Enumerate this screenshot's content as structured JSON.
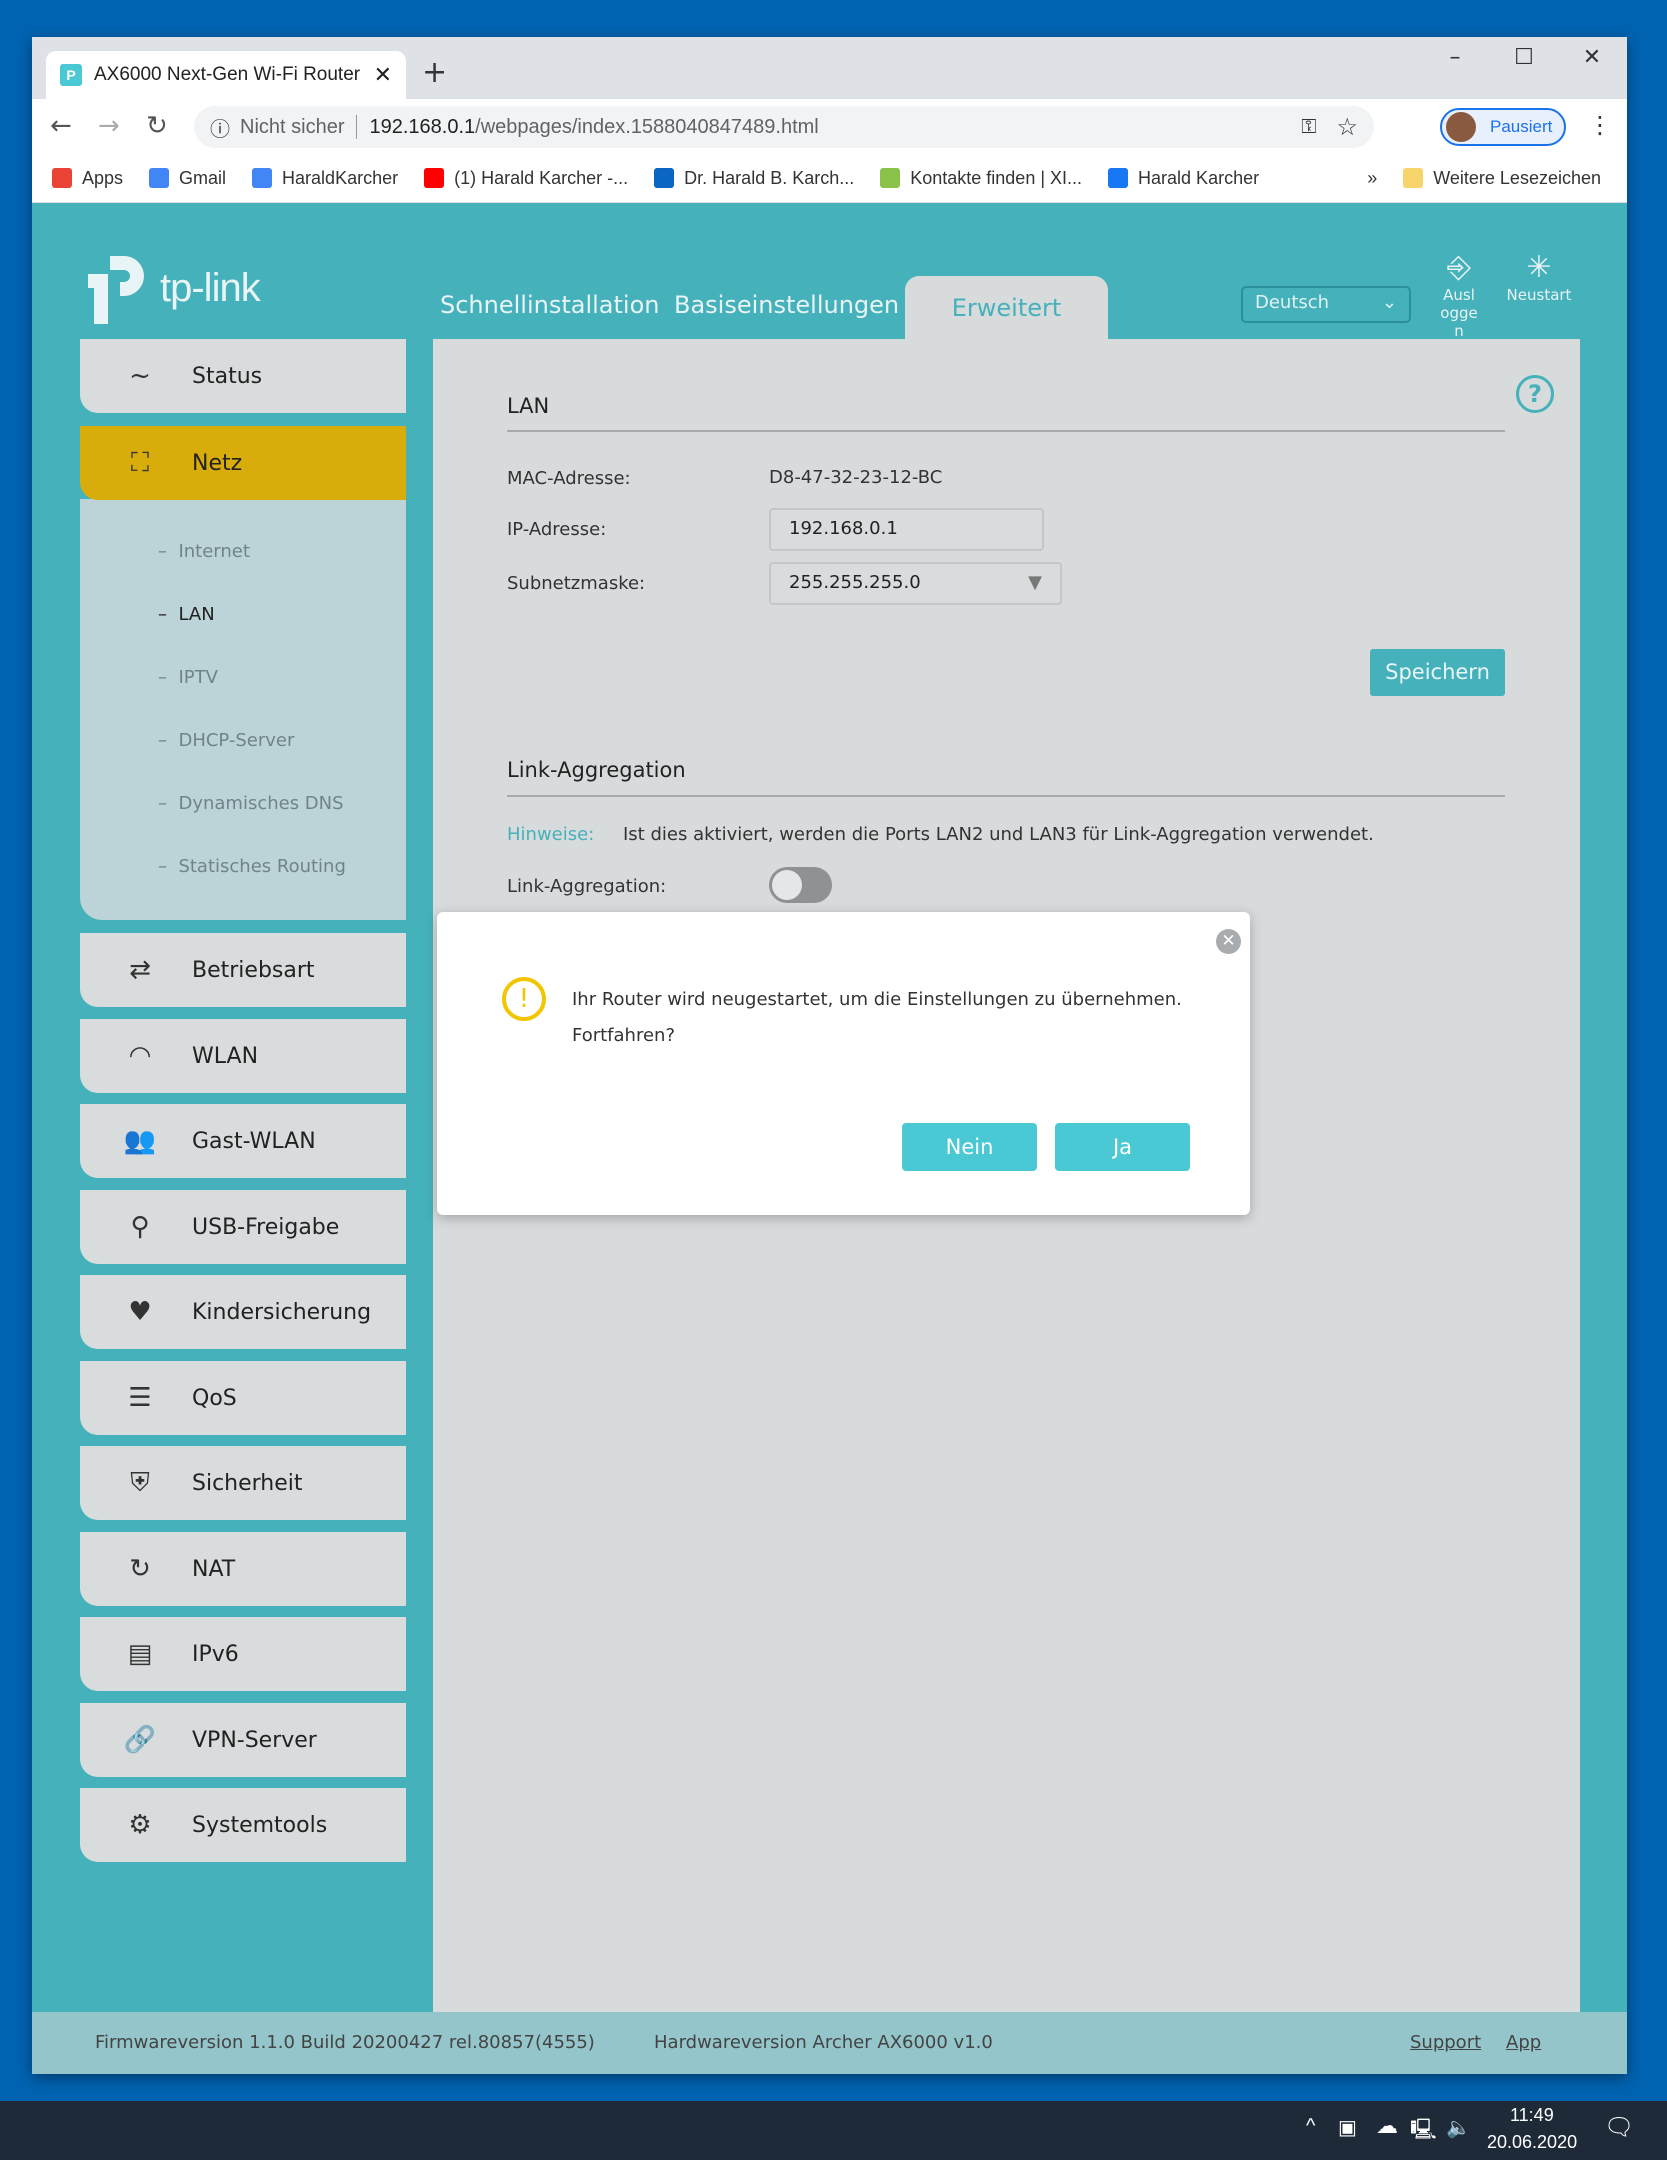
{
  "browser": {
    "tab_title": "AX6000 Next-Gen Wi-Fi Router",
    "not_secure": "Nicht sicher",
    "url_host": "192.168.0.1",
    "url_path": "/webpages/index.1588040847489.html",
    "profile": "Pausiert",
    "bookmarks": [
      {
        "label": "Apps",
        "icon": "apps-grid-icon",
        "color": "#ea4335"
      },
      {
        "label": "Gmail",
        "icon": "google-icon",
        "color": "#4285f4"
      },
      {
        "label": "HaraldKarcher",
        "icon": "page-icon",
        "color": "#4285f4"
      },
      {
        "label": "(1) Harald Karcher -...",
        "icon": "youtube-icon",
        "color": "#ff0000"
      },
      {
        "label": "Dr. Harald B. Karch...",
        "icon": "linkedin-icon",
        "color": "#0a66c2"
      },
      {
        "label": "Kontakte finden | XI...",
        "icon": "xing-icon",
        "color": "#8bc34a"
      },
      {
        "label": "Harald Karcher",
        "icon": "facebook-icon",
        "color": "#1877f2"
      }
    ],
    "more": "»",
    "other_bookmarks": "Weitere Lesezeichen"
  },
  "header": {
    "brand": "tp-link",
    "tabs": [
      "Schnellinstallation",
      "Basiseinstellungen",
      "Erweitert"
    ],
    "language": "Deutsch",
    "logout": "Ausloggen",
    "reboot": "Neustart"
  },
  "sidebar": {
    "items": [
      {
        "label": "Status",
        "icon": "~"
      },
      {
        "label": "Netz",
        "icon": "⛶"
      },
      {
        "label": "Betriebsart",
        "icon": "⇄"
      },
      {
        "label": "WLAN",
        "icon": "◠"
      },
      {
        "label": "Gast-WLAN",
        "icon": "👥"
      },
      {
        "label": "USB-Freigabe",
        "icon": "⚲"
      },
      {
        "label": "Kindersicherung",
        "icon": "♥"
      },
      {
        "label": "QoS",
        "icon": "☰"
      },
      {
        "label": "Sicherheit",
        "icon": "⛨"
      },
      {
        "label": "NAT",
        "icon": "↻"
      },
      {
        "label": "IPv6",
        "icon": "▤"
      },
      {
        "label": "VPN-Server",
        "icon": "🔗"
      },
      {
        "label": "Systemtools",
        "icon": "⚙"
      }
    ],
    "sub": [
      "Internet",
      "LAN",
      "IPTV",
      "DHCP-Server",
      "Dynamisches DNS",
      "Statisches Routing"
    ],
    "active_sub": 1
  },
  "lan": {
    "title": "LAN",
    "mac_label": "MAC-Adresse:",
    "mac": "D8-47-32-23-12-BC",
    "ip_label": "IP-Adresse:",
    "ip": "192.168.0.1",
    "mask_label": "Subnetzmaske:",
    "mask": "255.255.255.0",
    "save": "Speichern"
  },
  "la": {
    "title": "Link-Aggregation",
    "hint_label": "Hinweise:",
    "hint": "Ist dies aktiviert, werden die Ports LAN2 und LAN3 für Link-Aggregation verwendet.",
    "toggle_label": "Link-Aggregation:",
    "enabled": false
  },
  "dialog": {
    "line1": "Ihr Router wird neugestartet, um die Einstellungen zu übernehmen.",
    "line2": "Fortfahren?",
    "no": "Nein",
    "yes": "Ja"
  },
  "footer": {
    "firmware": "Firmwareversion 1.1.0 Build 20200427 rel.80857(4555)",
    "hardware": "Hardwareversion Archer AX6000 v1.0",
    "support": "Support",
    "app": "App"
  },
  "taskbar": {
    "time": "11:49",
    "date": "20.06.2020"
  }
}
